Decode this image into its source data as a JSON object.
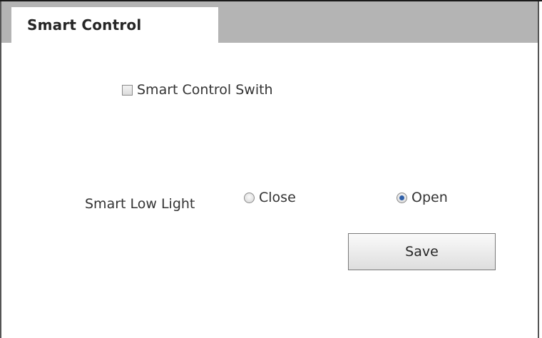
{
  "tabs": [
    {
      "label": "Smart Control",
      "active": true
    }
  ],
  "switch": {
    "label": "Smart Control Swith",
    "checked": false
  },
  "low_light": {
    "label": "Smart Low Light",
    "options": [
      {
        "label": "Close",
        "selected": false
      },
      {
        "label": "Open",
        "selected": true
      }
    ]
  },
  "save_label": "Save",
  "colors": {
    "tabbar": "#b4b4b4",
    "radio_selected": "#2f5fa8"
  }
}
